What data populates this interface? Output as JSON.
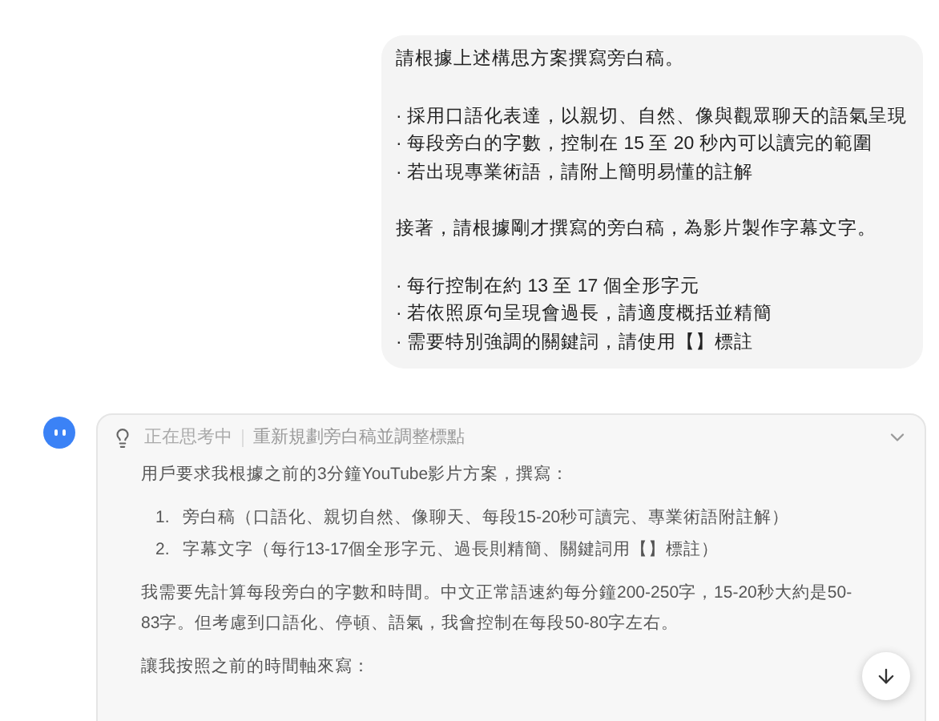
{
  "user_message": {
    "paragraphs": [
      {
        "kind": "text",
        "text": "請根據上述構思方案撰寫旁白稿。"
      },
      {
        "kind": "bullets",
        "items": [
          "· 採用口語化表達，以親切、自然、像與觀眾聊天的語氣呈現",
          "· 每段旁白的字數，控制在 15 至 20 秒內可以讀完的範圍",
          "· 若出現專業術語，請附上簡明易懂的註解"
        ]
      },
      {
        "kind": "text",
        "text": "接著，請根據剛才撰寫的旁白稿，為影片製作字幕文字。"
      },
      {
        "kind": "bullets",
        "items": [
          "· 每行控制在約 13 至 17 個全形字元",
          "· 若依照原句呈現會過長，請適度概括並精簡",
          "· 需要特別強調的關鍵詞，請使用【】標註"
        ]
      }
    ]
  },
  "thinking": {
    "status": "正在思考中",
    "title": "重新規劃旁白稿並調整標點",
    "expanded": true,
    "blocks": [
      {
        "kind": "text",
        "text": "用戶要求我根據之前的3分鐘YouTube影片方案，撰寫："
      },
      {
        "kind": "numbered",
        "items": [
          {
            "number": "1.",
            "text": "旁白稿（口語化、親切自然、像聊天、每段15-20秒可讀完、專業術語附註解）"
          },
          {
            "number": "2.",
            "text": "字幕文字（每行13-17個全形字元、過長則精簡、關鍵詞用【】標註）"
          }
        ]
      },
      {
        "kind": "text",
        "text": "我需要先計算每段旁白的字數和時間。中文正常語速約每分鐘200-250字，15-20秒大約是50-83字。但考慮到口語化、停頓、語氣，我會控制在每段50-80字左右。"
      },
      {
        "kind": "text",
        "text": "讓我按照之前的時間軸來寫："
      }
    ]
  }
}
